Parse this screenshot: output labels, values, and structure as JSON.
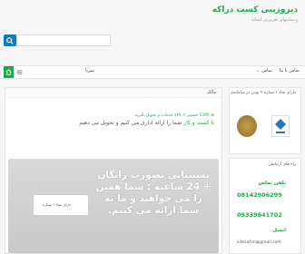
{
  "header": {
    "title": "دیروزیبی کست دراکه",
    "subtitle": "و سایتهای تعزیرتی اسانه"
  },
  "search": {
    "placeholder": ""
  },
  "nav": {
    "links": [
      "تماس با ما",
      "تماس ...",
      "سریا"
    ]
  },
  "main": {
    "header_title": "مالک",
    "meta": "⊕ 1395 حسینر ۲، ۷۴۹ خدمات و تحویل بگیرید",
    "intro_link": "با کست و کار",
    "intro_rest": " شما را ارائه اداری می کنیم و تحویل می دهیم",
    "banner_text": "پشتیبانی بصورت رایگان + 24 ساعته : شما همین را می خواهید و ما به شما ارائه می کنیم.",
    "banner_box_label": "دارای نماد ۱ ستاره"
  },
  "sidebar": {
    "badge_heading": "دارای نماد ۱ ستاره ۲ بودن در سامانه‌ی",
    "contact_heading": "راه های ارتباطی",
    "contacts": [
      {
        "label": "تلفن تماس",
        "value": "08142906299"
      },
      {
        "label": "",
        "value": "09339641702"
      },
      {
        "label": "ایمیل",
        "value": "sitesafrin@gmail.com"
      }
    ]
  },
  "colors": {
    "accent": "#1fa84a",
    "search": "#0c7bc4"
  }
}
